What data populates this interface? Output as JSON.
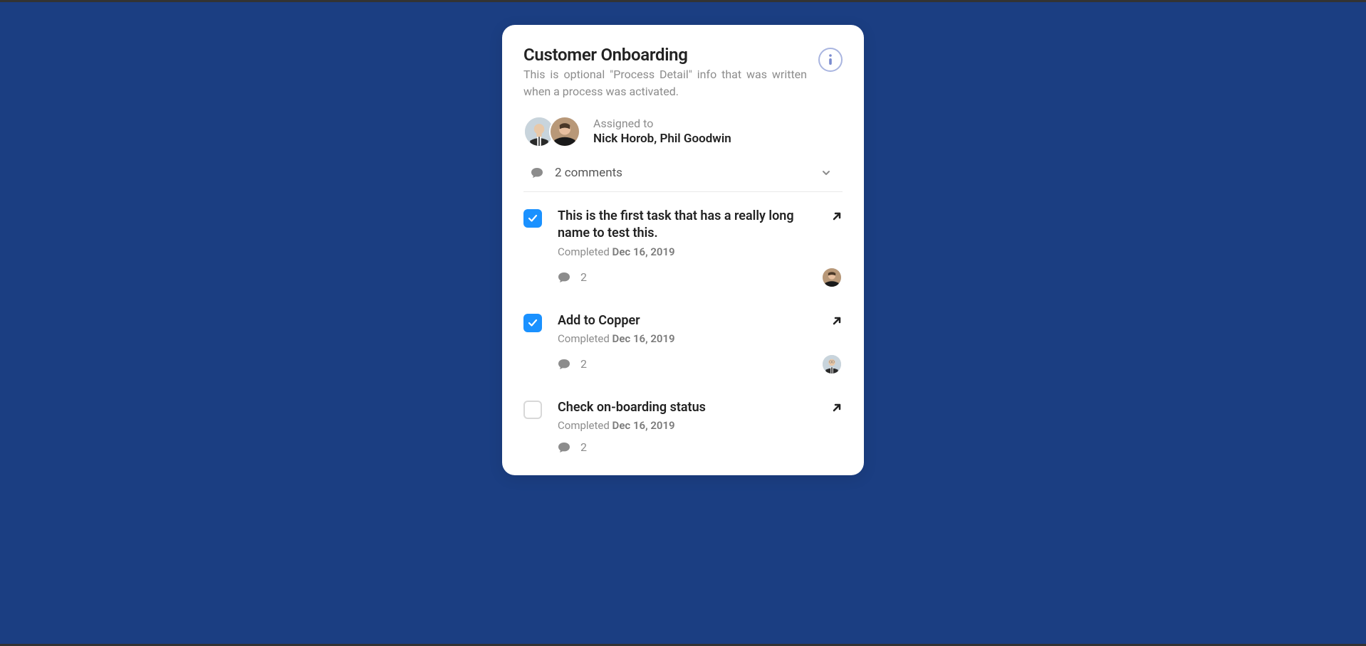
{
  "card": {
    "title": "Customer Onboarding",
    "description": "This is optional \"Process Detail\" info that was written when a process was activated."
  },
  "assignment": {
    "label": "Assigned to",
    "names": "Nick Horob, Phil Goodwin"
  },
  "comments": {
    "label": "2 comments"
  },
  "tasks": [
    {
      "checked": true,
      "title": "This is the first task that has a really long name to test this.",
      "completed_label": "Completed ",
      "date": "Dec 16, 2019",
      "comment_count": "2",
      "has_avatar": true,
      "avatar_idx": 1
    },
    {
      "checked": true,
      "title": "Add to Copper",
      "completed_label": "Completed ",
      "date": "Dec 16, 2019",
      "comment_count": "2",
      "has_avatar": true,
      "avatar_idx": 0
    },
    {
      "checked": false,
      "title": "Check on-boarding status",
      "completed_label": "Completed ",
      "date": "Dec 16, 2019",
      "comment_count": "2",
      "has_avatar": false
    }
  ]
}
